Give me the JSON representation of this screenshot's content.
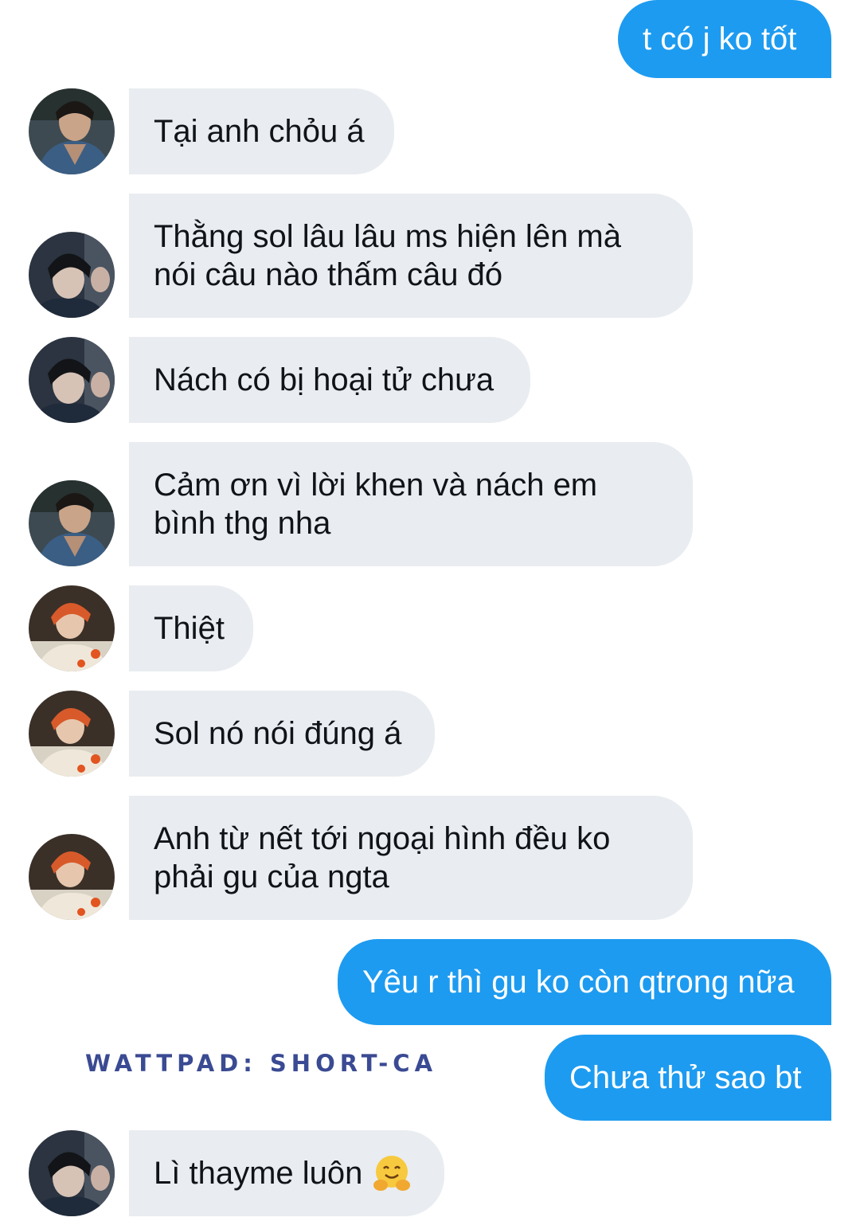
{
  "conversation": {
    "messages": [
      {
        "sender": "me",
        "text": "t có j ko tốt"
      },
      {
        "sender": "friend",
        "avatar": "avatar-denim",
        "text": "Tại anh chỏu á"
      },
      {
        "sender": "friend",
        "avatar": "avatar-dark",
        "text": "Thằng sol lâu lâu ms hiện lên mà\nnói câu nào thấm câu đó"
      },
      {
        "sender": "friend",
        "avatar": "avatar-dark",
        "text": "Nách có bị hoại tử chưa"
      },
      {
        "sender": "friend",
        "avatar": "avatar-denim",
        "text": "Cảm ơn vì lời khen và nách em\nbình thg nha"
      },
      {
        "sender": "friend",
        "avatar": "avatar-orange",
        "text": "Thiệt"
      },
      {
        "sender": "friend",
        "avatar": "avatar-orange",
        "text": "Sol nó nói đúng á"
      },
      {
        "sender": "friend",
        "avatar": "avatar-orange",
        "text": "Anh từ nết tới ngoại hình đều ko\nphải gu của ngta"
      },
      {
        "sender": "me",
        "text": "Yêu r thì gu ko còn qtrong nữa"
      },
      {
        "sender": "me",
        "text": "Chưa thử sao bt"
      },
      {
        "sender": "friend",
        "avatar": "avatar-dark",
        "text": "Lì thayme luôn",
        "emoji": "hugging-face-emoji"
      }
    ]
  },
  "watermark": "WATTPAD: SHORT-CA",
  "colors": {
    "outgoing_bubble": "#1d9bf0",
    "incoming_bubble": "#e9ecf0",
    "watermark": "#3a4a93"
  }
}
